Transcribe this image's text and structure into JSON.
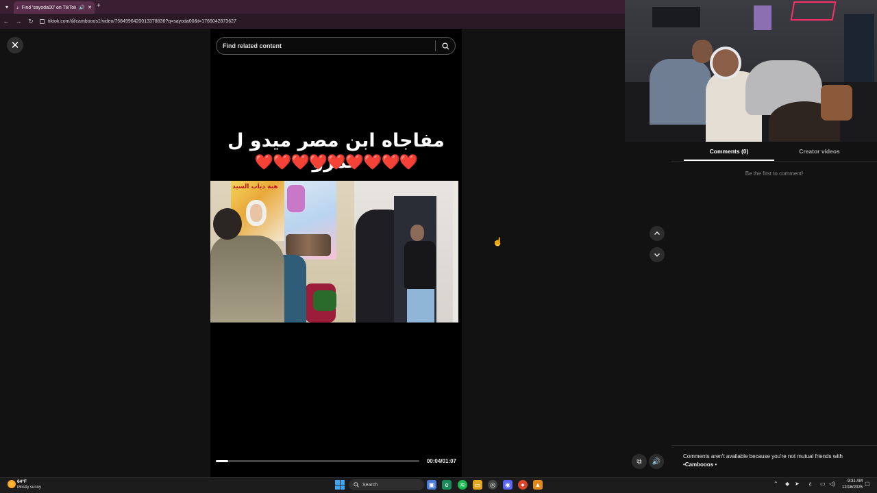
{
  "browser": {
    "tab_title": "Find 'sayoda00' on TikTok |",
    "url": "tiktok.com/@cambooos1/video/7584996420013378836?q=sayoda00&t=1766042873627"
  },
  "player": {
    "search_placeholder": "Find related content",
    "caption": "مفاجاه ابن مصر ميدو ل عمرو",
    "hearts": "❤️❤️❤️❤️❤️❤️❤️❤️❤️",
    "poster_text": "هبة دياب السيد",
    "time": "00:04/01:07",
    "progress": 0.06
  },
  "panel": {
    "tab_comments": "Comments (0)",
    "tab_creator": "Creator videos",
    "empty_text": "Be the first to comment!",
    "not_friends_line1": "Comments aren't available because you're not mutual friends with",
    "not_friends_line2": "•Cambooos •"
  },
  "taskbar": {
    "weather_temp": "64°F",
    "weather_desc": "Mostly sunny",
    "search_label": "Search",
    "time": "9:31 AM",
    "date": "12/18/2025"
  },
  "colors": {
    "tab_bar": "#3a1f33",
    "heart": "#e2142a",
    "page_bg": "#121212"
  },
  "icons": [
    "close-icon",
    "search-icon",
    "chevron-up-icon",
    "chevron-down-icon",
    "pip-icon",
    "volume-icon",
    "windows-start-icon"
  ]
}
